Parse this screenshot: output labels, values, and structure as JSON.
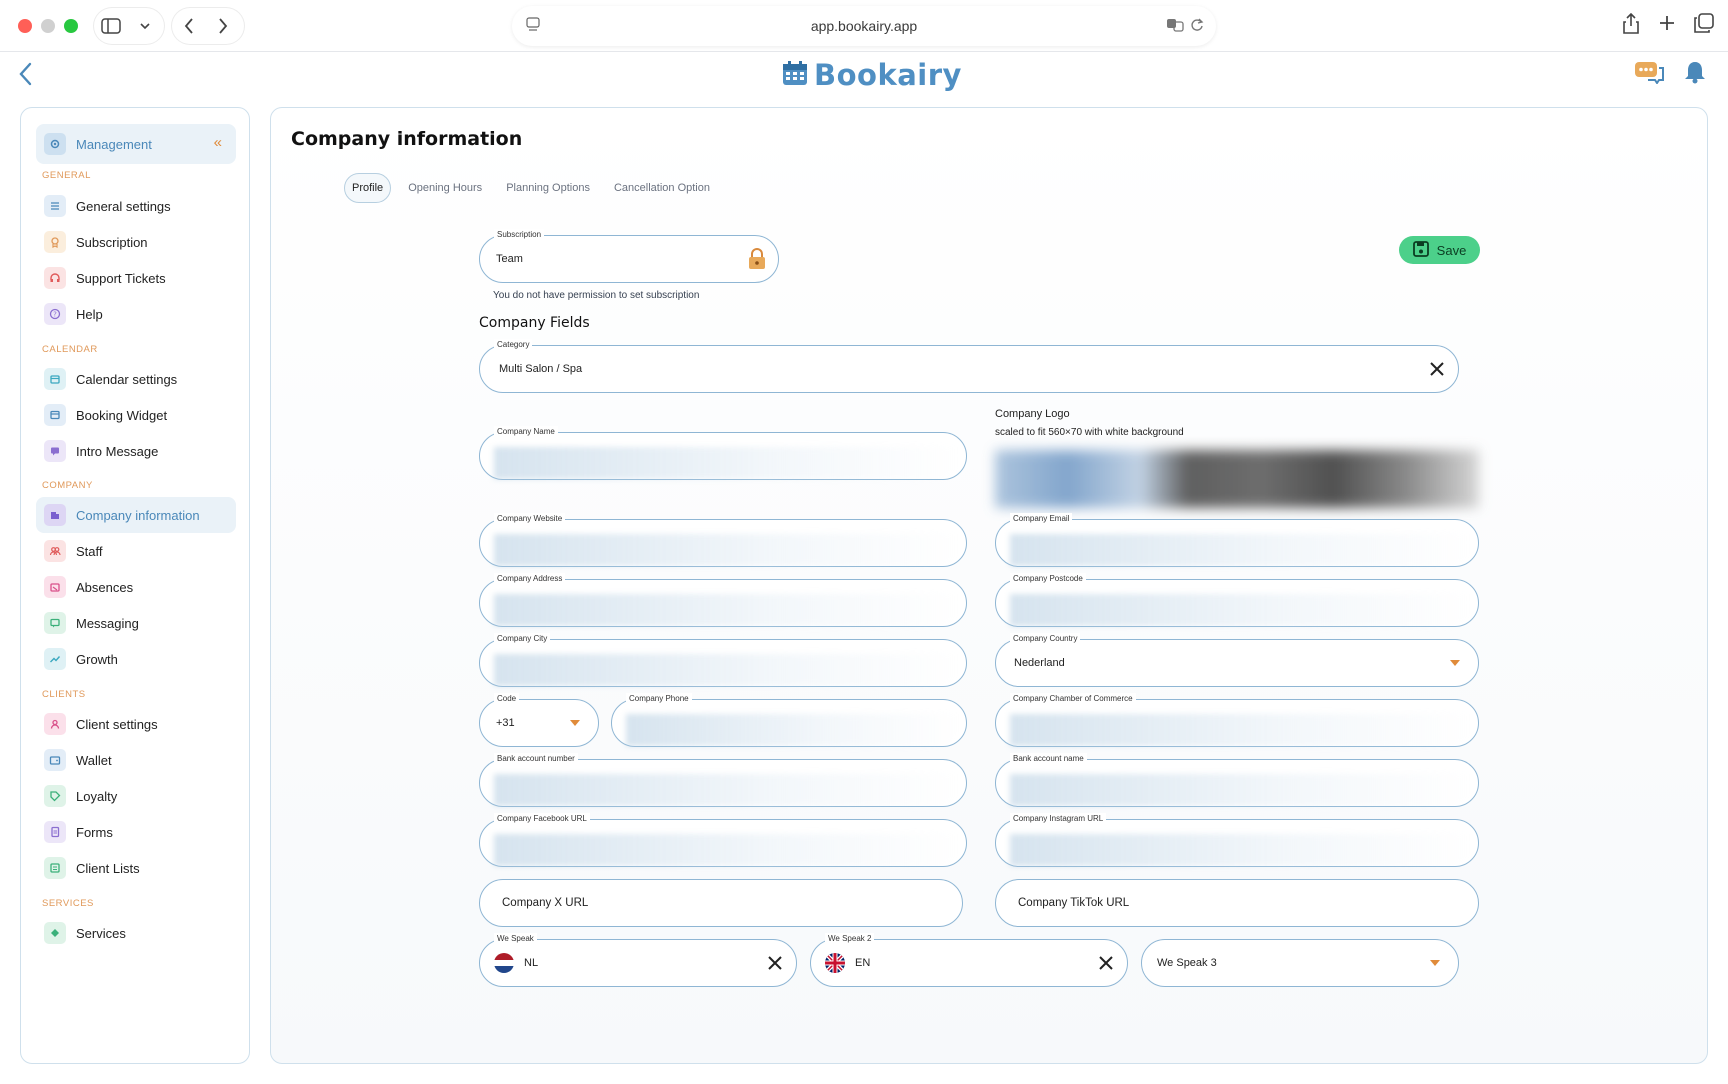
{
  "browser": {
    "url": "app.bookairy.app"
  },
  "app": {
    "brand": "Bookairy"
  },
  "sidebar": {
    "header": "Management",
    "sections": [
      {
        "label": "GENERAL",
        "items": [
          "General settings",
          "Subscription",
          "Support Tickets",
          "Help"
        ]
      },
      {
        "label": "CALENDAR",
        "items": [
          "Calendar settings",
          "Booking Widget",
          "Intro Message"
        ]
      },
      {
        "label": "COMPANY",
        "items": [
          "Company information",
          "Staff",
          "Absences",
          "Messaging",
          "Growth"
        ]
      },
      {
        "label": "CLIENTS",
        "items": [
          "Client settings",
          "Wallet",
          "Loyalty",
          "Forms",
          "Client Lists"
        ]
      },
      {
        "label": "SERVICES",
        "items": [
          "Services"
        ]
      }
    ],
    "active_item": "Company information"
  },
  "main": {
    "title": "Company information",
    "tabs": [
      "Profile",
      "Opening Hours",
      "Planning Options",
      "Cancellation Option"
    ],
    "active_tab": "Profile",
    "save_label": "Save",
    "subscription": {
      "label": "Subscription",
      "value": "Team",
      "note": "You do not have permission to set subscription"
    },
    "section_title": "Company Fields",
    "category": {
      "label": "Category",
      "value": "Multi Salon / Spa"
    },
    "logo": {
      "title": "Company Logo",
      "subtitle": "scaled to fit 560×70 with white background"
    },
    "fields": {
      "company_name": "Company Name",
      "company_website": "Company Website",
      "company_email": "Company Email",
      "company_address": "Company Address",
      "company_postcode": "Company Postcode",
      "company_city": "Company City",
      "company_country": {
        "label": "Company Country",
        "value": "Nederland"
      },
      "code": {
        "label": "Code",
        "value": "+31"
      },
      "company_phone": "Company Phone",
      "chamber": "Company Chamber of Commerce",
      "bank_number": "Bank account number",
      "bank_name": "Bank account name",
      "facebook": "Company Facebook URL",
      "instagram": "Company Instagram URL",
      "x_url": "Company X URL",
      "tiktok_url": "Company TikTok URL"
    },
    "languages": [
      {
        "label": "We Speak",
        "value": "NL",
        "flag": "netherlands-flag"
      },
      {
        "label": "We Speak 2",
        "value": "EN",
        "flag": "uk-flag"
      },
      {
        "placeholder": "We Speak 3"
      }
    ]
  },
  "colors": {
    "accent": "#4a88b9",
    "save": "#4cd08a",
    "caret": "#e08b3a",
    "section": "#e0995a"
  }
}
